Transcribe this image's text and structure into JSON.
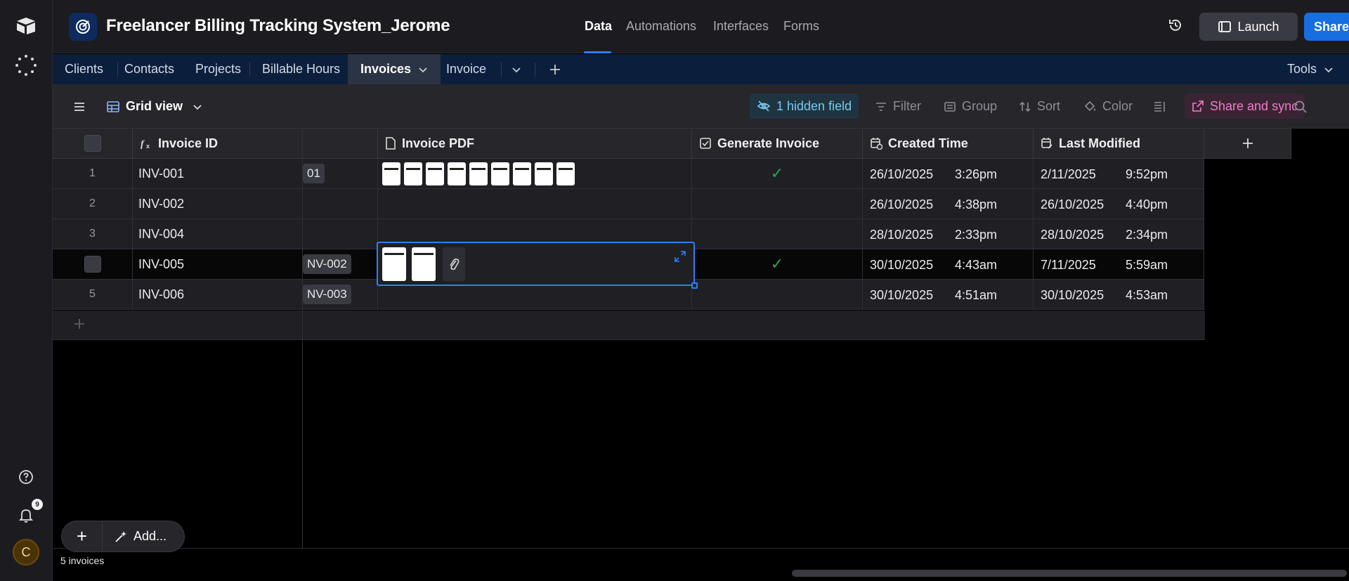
{
  "app": {
    "base_name": "Freelancer Billing Tracking System_Jerome",
    "nav": [
      "Data",
      "Automations",
      "Interfaces",
      "Forms"
    ],
    "launch_label": "Launch",
    "share_label": "Share",
    "notification_count": "9",
    "avatar_initial": "C"
  },
  "tables": {
    "tabs": [
      "Clients",
      "Contacts",
      "Projects",
      "Billable Hours",
      "Invoices",
      "Invoice"
    ],
    "tools_label": "Tools"
  },
  "view": {
    "name": "Grid view",
    "hidden_fields": "1 hidden field",
    "filter": "Filter",
    "group": "Group",
    "sort": "Sort",
    "color": "Color",
    "share_sync": "Share and sync"
  },
  "columns": {
    "invoice_id": "Invoice ID",
    "invoice_pdf": "Invoice PDF",
    "generate_invoice": "Generate Invoice",
    "created_time": "Created Time",
    "last_modified": "Last Modified"
  },
  "rows": [
    {
      "num": "1",
      "id": "INV-001",
      "link": "01",
      "created_date": "26/10/2025",
      "created_time": "3:26pm",
      "mod_date": "2/11/2025",
      "mod_time": "9:52pm",
      "attachments": 9,
      "generated": true
    },
    {
      "num": "2",
      "id": "INV-002",
      "link": "",
      "created_date": "26/10/2025",
      "created_time": "4:38pm",
      "mod_date": "26/10/2025",
      "mod_time": "4:40pm",
      "attachments": 0,
      "generated": false
    },
    {
      "num": "3",
      "id": "INV-004",
      "link": "",
      "created_date": "28/10/2025",
      "created_time": "2:33pm",
      "mod_date": "28/10/2025",
      "mod_time": "2:34pm",
      "attachments": 0,
      "generated": false
    },
    {
      "num": "",
      "id": "INV-005",
      "link": "NV-002",
      "created_date": "30/10/2025",
      "created_time": "4:43am",
      "mod_date": "7/11/2025",
      "mod_time": "5:59am",
      "attachments": 2,
      "generated": true
    },
    {
      "num": "5",
      "id": "INV-006",
      "link": "NV-003",
      "created_date": "30/10/2025",
      "created_time": "4:51am",
      "mod_date": "30/10/2025",
      "mod_time": "4:53am",
      "attachments": 0,
      "generated": false
    }
  ],
  "footer": {
    "record_count": "5 invoices",
    "add_label": "Add..."
  }
}
